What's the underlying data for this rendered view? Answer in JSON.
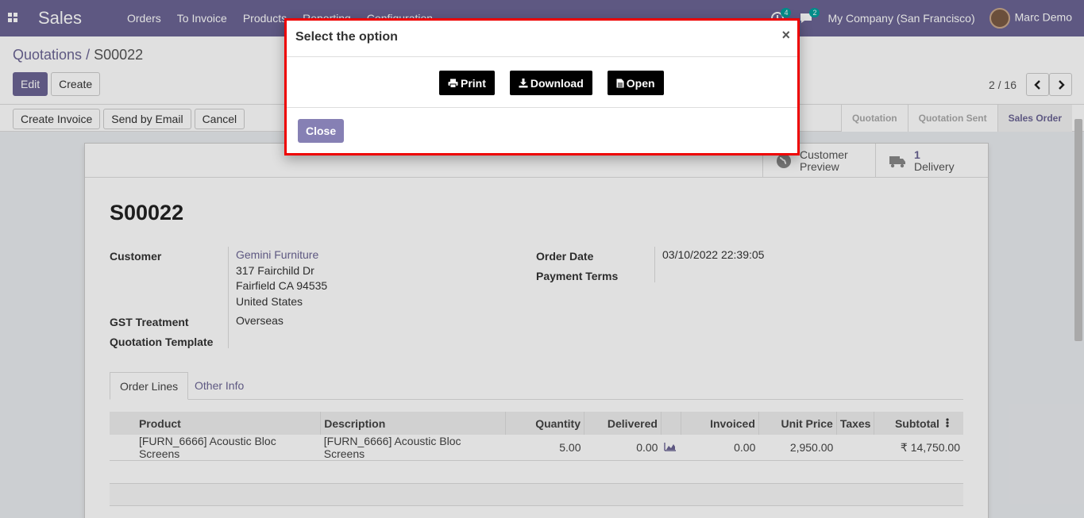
{
  "navbar": {
    "brand": "Sales",
    "menu": [
      "Orders",
      "To Invoice",
      "Products",
      "Reporting",
      "Configuration"
    ],
    "activity_count": "4",
    "message_count": "2",
    "company": "My Company (San Francisco)",
    "user": "Marc Demo"
  },
  "breadcrumb": {
    "parent": "Quotations",
    "separator": " / ",
    "current": "S00022"
  },
  "control": {
    "edit_label": "Edit",
    "create_label": "Create",
    "pager": "2 / 16"
  },
  "statusbar": {
    "buttons": [
      "Create Invoice",
      "Send by Email",
      "Cancel"
    ],
    "stages": [
      "Quotation",
      "Quotation Sent",
      "Sales Order"
    ]
  },
  "smart_buttons": {
    "customer_preview": [
      "Customer",
      "Preview"
    ],
    "delivery_count": "1",
    "delivery_label": "Delivery"
  },
  "form": {
    "name": "S00022",
    "customer_label": "Customer",
    "customer_name": "Gemini Furniture",
    "address": [
      "317 Fairchild Dr",
      "Fairfield CA 94535",
      "United States"
    ],
    "gst_label": "GST Treatment",
    "gst_value": "Overseas",
    "template_label": "Quotation Template",
    "order_date_label": "Order Date",
    "order_date": "03/10/2022 22:39:05",
    "payment_terms_label": "Payment Terms"
  },
  "tabs": [
    "Order Lines",
    "Other Info"
  ],
  "order_lines": {
    "columns": [
      "Product",
      "Description",
      "Quantity",
      "Delivered",
      "Invoiced",
      "Unit Price",
      "Taxes",
      "Subtotal"
    ],
    "rows": [
      {
        "product": "[FURN_6666] Acoustic Bloc Screens",
        "description": "[FURN_6666] Acoustic Bloc Screens",
        "quantity": "5.00",
        "delivered": "0.00",
        "invoiced": "0.00",
        "unit_price": "2,950.00",
        "taxes": "",
        "subtotal": "₹ 14,750.00"
      }
    ]
  },
  "modal": {
    "title": "Select the option",
    "close_x": "×",
    "options": [
      "Print",
      "Download",
      "Open"
    ],
    "close_label": "Close"
  },
  "colors": {
    "brand": "#6b6594",
    "highlight_border": "#e00000",
    "option_button": "#000000"
  }
}
